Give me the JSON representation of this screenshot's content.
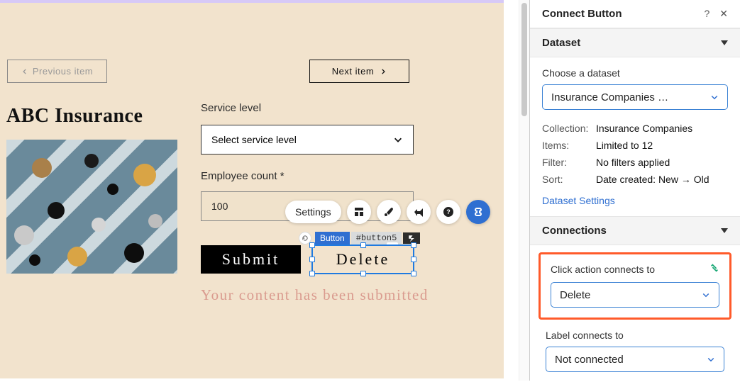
{
  "canvas": {
    "prev_label": "Previous item",
    "next_label": "Next item",
    "company_title": "ABC Insurance",
    "service_level_label": "Service level",
    "service_level_placeholder": "Select service level",
    "employee_count_label": "Employee count *",
    "employee_count_value": "100",
    "submit_label": "Submit",
    "delete_label": "Delete",
    "success_message": "Your content has been submitted",
    "selection_tag_type": "Button",
    "selection_tag_id": "#button5"
  },
  "toolbar": {
    "settings_label": "Settings"
  },
  "panel": {
    "title": "Connect Button",
    "dataset_section": "Dataset",
    "choose_dataset_label": "Choose a dataset",
    "dataset_selected": "Insurance Companies …",
    "meta": {
      "collection_key": "Collection:",
      "collection_val": "Insurance Companies",
      "items_key": "Items:",
      "items_val": "Limited to 12",
      "filter_key": "Filter:",
      "filter_val": "No filters applied",
      "sort_key": "Sort:",
      "sort_val": "Date created: New → Old"
    },
    "dataset_settings_link": "Dataset Settings",
    "connections_section": "Connections",
    "click_action_label": "Click action connects to",
    "click_action_value": "Delete",
    "label_connects_label": "Label connects to",
    "label_connects_value": "Not connected"
  }
}
